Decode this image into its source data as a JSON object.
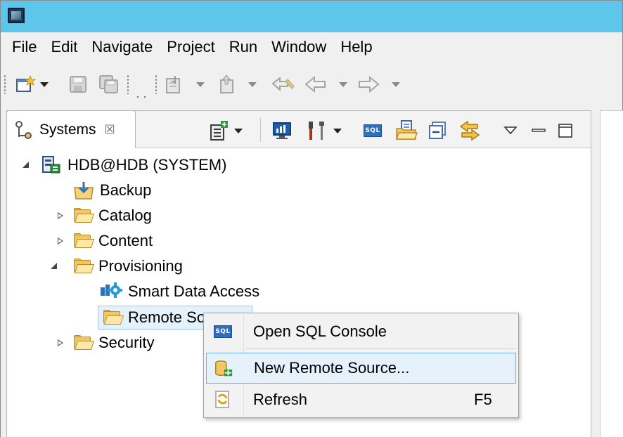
{
  "menubar": {
    "items": [
      "File",
      "Edit",
      "Navigate",
      "Project",
      "Run",
      "Window",
      "Help"
    ]
  },
  "toolbar": {
    "icons": [
      "new-wizard-icon",
      "save-icon",
      "save-all-icon",
      "open-type-icon",
      "search-icon",
      "last-edit-icon",
      "back-icon",
      "forward-icon"
    ]
  },
  "view": {
    "tab_label": "Systems",
    "tab_close": "☒",
    "toolbar_icons": [
      "add-system-icon",
      "monitor-icon",
      "tools-icon",
      "sql-console-icon",
      "open-folder-icon",
      "collapse-all-icon",
      "link-editor-icon",
      "view-menu-icon",
      "minimize-icon",
      "maximize-icon"
    ],
    "sql_badge": "SQL"
  },
  "tree": {
    "root": "HDB@HDB (SYSTEM)",
    "backup": "Backup",
    "catalog": "Catalog",
    "content": "Content",
    "provisioning": "Provisioning",
    "smart_data_access": "Smart Data Access",
    "remote_sources": "Remote Sources",
    "security": "Security"
  },
  "context_menu": {
    "open_sql_console": "Open SQL Console",
    "new_remote_source": "New Remote Source...",
    "refresh": "Refresh",
    "refresh_shortcut": "F5",
    "sql_badge": "SQL"
  },
  "colors": {
    "titlebar": "#5ec6ea",
    "selection_bg": "#e5f1fb",
    "selection_border": "#99c9ef",
    "highlight_border": "#6fb1e5",
    "folder": "#f1c764"
  }
}
